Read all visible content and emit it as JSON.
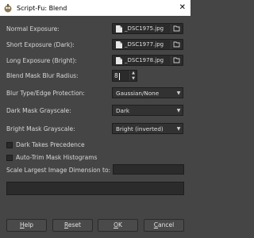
{
  "window": {
    "title": "Script-Fu: Blend",
    "close_symbol": "✕"
  },
  "fields": {
    "normal_exposure": {
      "label": "Normal Exposure:",
      "file": "_DSC1975.jpg"
    },
    "short_exposure": {
      "label": "Short Exposure (Dark):",
      "file": "_DSC1977.jpg"
    },
    "long_exposure": {
      "label": "Long Exposure (Bright):",
      "file": "_DSC1978.jpg"
    },
    "blur_radius": {
      "label": "Blend Mask Blur Radius:",
      "value": "8"
    },
    "blur_type": {
      "label": "Blur Type/Edge Protection:",
      "value": "Gaussian/None"
    },
    "dark_mask": {
      "label": "Dark Mask Grayscale:",
      "value": "Dark"
    },
    "bright_mask": {
      "label": "Bright Mask Grayscale:",
      "value": "Bright (inverted)"
    },
    "dark_precedence": {
      "label": "Dark Takes Precedence",
      "checked": false
    },
    "auto_trim": {
      "label": "Auto-Trim Mask Histograms",
      "checked": false
    },
    "scale_largest": {
      "label": "Scale Largest Image Dimension to:",
      "value": ""
    }
  },
  "buttons": {
    "help": {
      "mn": "H",
      "rest": "elp"
    },
    "reset": {
      "mn": "R",
      "rest": "eset"
    },
    "ok": {
      "mn": "O",
      "rest": "K"
    },
    "cancel": {
      "mn": "C",
      "rest": "ancel"
    }
  },
  "icons": {
    "spin_up": "▲",
    "spin_down": "▼",
    "combo_arrow": "▼"
  }
}
